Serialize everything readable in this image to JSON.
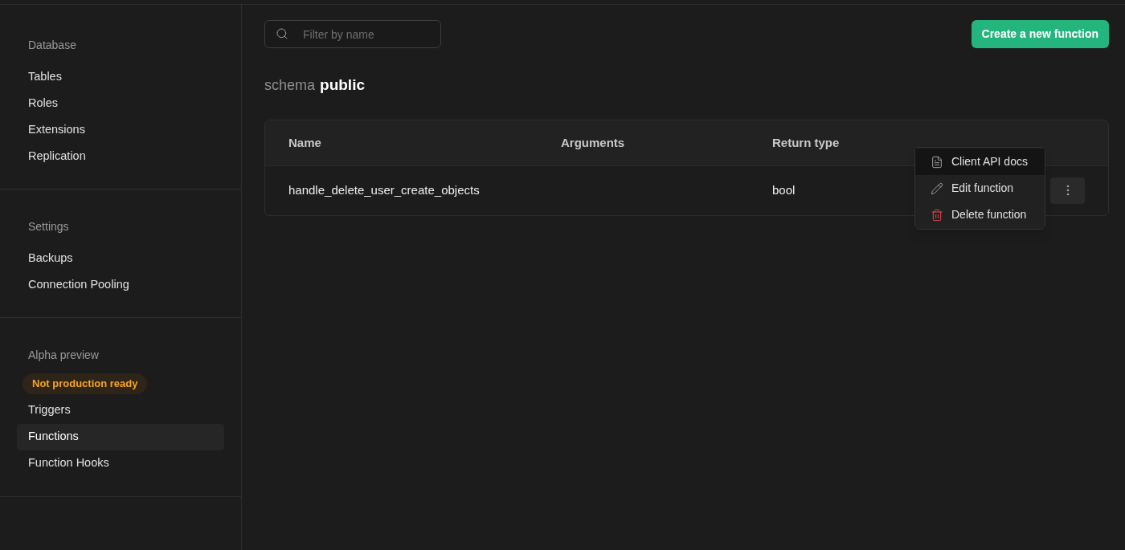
{
  "sidebar": {
    "sections": [
      {
        "title": "Database",
        "items": [
          {
            "label": "Tables",
            "selected": false
          },
          {
            "label": "Roles",
            "selected": false
          },
          {
            "label": "Extensions",
            "selected": false
          },
          {
            "label": "Replication",
            "selected": false
          }
        ]
      },
      {
        "title": "Settings",
        "items": [
          {
            "label": "Backups",
            "selected": false
          },
          {
            "label": "Connection Pooling",
            "selected": false
          }
        ]
      },
      {
        "title": "Alpha preview",
        "badge": "Not production ready",
        "items": [
          {
            "label": "Triggers",
            "selected": false
          },
          {
            "label": "Functions",
            "selected": true
          },
          {
            "label": "Function Hooks",
            "selected": false
          }
        ]
      }
    ]
  },
  "search": {
    "placeholder": "Filter by name"
  },
  "create_button": "Create a new function",
  "schema": {
    "label": "schema",
    "name": "public"
  },
  "table": {
    "columns": [
      "Name",
      "Arguments",
      "Return type"
    ],
    "rows": [
      {
        "cells": [
          "handle_delete_user_create_objects",
          "",
          "bool"
        ]
      }
    ]
  },
  "menu": {
    "items": [
      {
        "kind": "docs",
        "label": "Client API docs",
        "selected": true
      },
      {
        "kind": "edit",
        "label": "Edit function",
        "selected": false
      },
      {
        "kind": "delete",
        "label": "Delete function",
        "selected": false
      }
    ]
  }
}
